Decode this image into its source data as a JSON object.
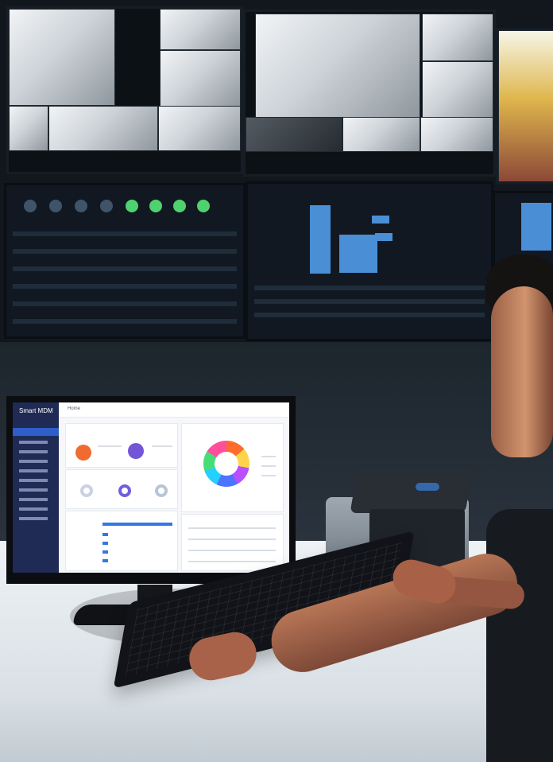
{
  "monitor": {
    "app_name": "Smart MDM",
    "page_title": "Home"
  }
}
